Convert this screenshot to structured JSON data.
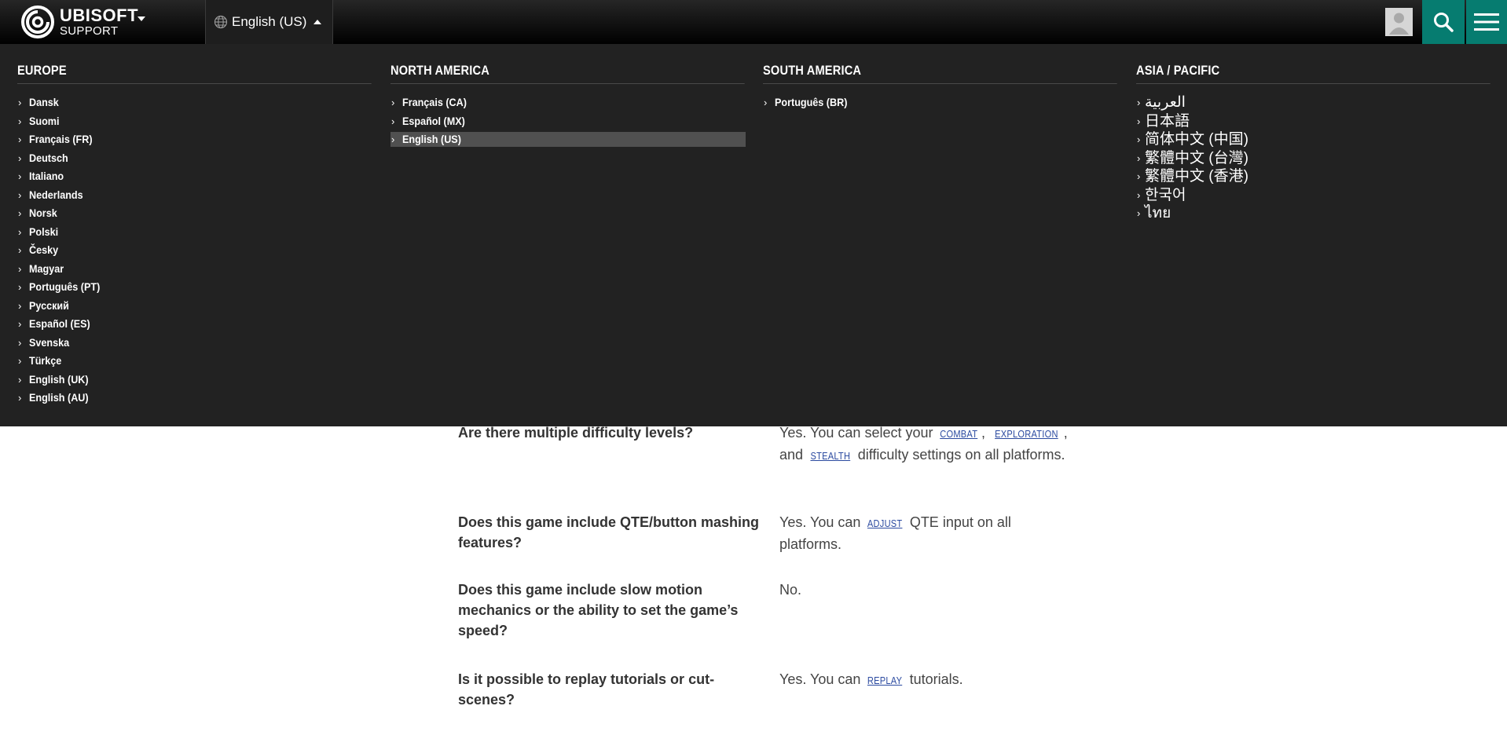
{
  "header": {
    "logo_brand": "UBISOFT",
    "logo_sub": "SUPPORT",
    "language_button": "English (US)",
    "icons": {
      "logo": "ubisoft-swirl-logo",
      "logo_menu": "caret-down-icon",
      "language": "globe-icon",
      "language_caret": "caret-up-icon",
      "avatar": "user-avatar-icon",
      "search": "search-icon",
      "menu": "hamburger-menu-icon"
    },
    "accent_color": "#067c70"
  },
  "language_menu": {
    "regions": [
      {
        "title": "EUROPE",
        "items": [
          "Dansk",
          "Suomi",
          "Français (FR)",
          "Deutsch",
          "Italiano",
          "Nederlands",
          "Norsk",
          "Polski",
          "Česky",
          "Magyar",
          "Português (PT)",
          "Русский",
          "Español (ES)",
          "Svenska",
          "Türkçe",
          "English (UK)",
          "English (AU)"
        ]
      },
      {
        "title": "NORTH AMERICA",
        "items": [
          "Français (CA)",
          "Español (MX)",
          "English (US)"
        ],
        "selected": "English (US)"
      },
      {
        "title": "SOUTH AMERICA",
        "items": [
          "Português (BR)"
        ]
      },
      {
        "title": "ASIA / PACIFIC",
        "items": [
          "العربية",
          "日本語",
          "简体中文 (中国)",
          "繁體中文 (台灣)",
          "繁體中文 (香港)",
          "한국어",
          "ไทย"
        ]
      }
    ]
  },
  "faq": [
    {
      "question": "Are there multiple difficulty levels?",
      "answer_parts": [
        "Yes. You can select your ",
        "COMBAT",
        ", ",
        "EXPLORATION",
        ", and ",
        "STEALTH",
        " difficulty settings on all platforms."
      ]
    },
    {
      "question": "Does this game include QTE/button mashing features?",
      "answer_parts": [
        "Yes. You can ",
        "ADJUST",
        " QTE input on all platforms."
      ]
    },
    {
      "question": "Does this game include slow motion mechanics or the ability to set the game’s speed?",
      "answer": "No."
    },
    {
      "question": "Is it possible to replay tutorials or cut-scenes?",
      "answer_parts": [
        "Yes. You can ",
        "REPLAY",
        " tutorials."
      ]
    }
  ]
}
